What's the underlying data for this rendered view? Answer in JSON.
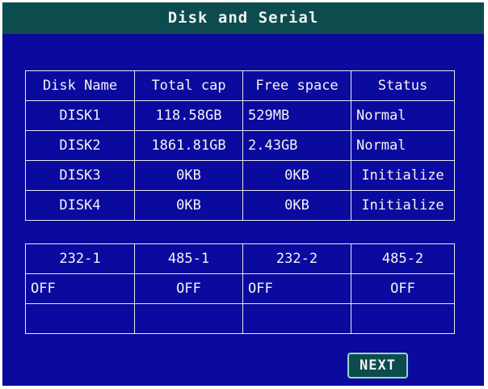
{
  "title": "Disk and Serial",
  "disk_table": {
    "headers": [
      "Disk Name",
      "Total cap",
      "Free space",
      "Status"
    ],
    "rows": [
      [
        "DISK1",
        "118.58GB",
        "529MB",
        "Normal"
      ],
      [
        "DISK2",
        "1861.81GB",
        "2.43GB",
        "Normal"
      ],
      [
        "DISK3",
        "0KB",
        "0KB",
        "Initialize"
      ],
      [
        "DISK4",
        "0KB",
        "0KB",
        "Initialize"
      ]
    ]
  },
  "serial_table": {
    "headers": [
      "232-1",
      "485-1",
      "232-2",
      "485-2"
    ],
    "values": [
      "OFF",
      "OFF",
      "OFF",
      "OFF"
    ]
  },
  "buttons": {
    "next_label": "NEXT"
  },
  "colors": {
    "background": "#0b0a9e",
    "titlebar": "#0c4c4e",
    "text": "#f4f4f4"
  }
}
